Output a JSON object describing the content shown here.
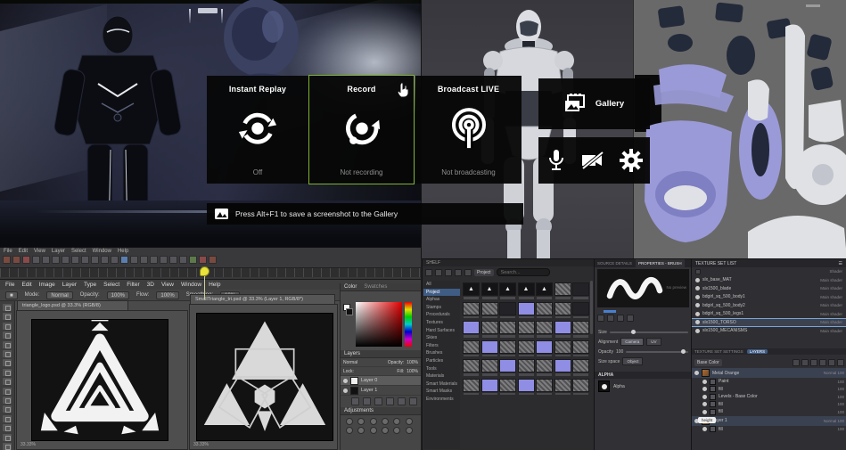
{
  "overlay": {
    "tiles": [
      {
        "title": "Instant Replay",
        "status": "Off"
      },
      {
        "title": "Record",
        "status": "Not recording"
      },
      {
        "title": "Broadcast LIVE",
        "status": "Not broadcasting"
      }
    ],
    "gallery_label": "Gallery",
    "notification": "Press Alt+F1 to save a screenshot to the Gallery",
    "accent_green": "#7fb22e"
  },
  "upper_app": {
    "menus": [
      "File",
      "Edit",
      "View",
      "Layer",
      "Select",
      "Window",
      "Help"
    ]
  },
  "photoshop": {
    "menus": [
      "File",
      "Edit",
      "Image",
      "Layer",
      "Type",
      "Select",
      "Filter",
      "3D",
      "View",
      "Window",
      "Help"
    ],
    "options": {
      "mode_label": "Mode:",
      "mode": "Normal",
      "opacity_label": "Opacity:",
      "opacity": "100%",
      "flow_label": "Flow:",
      "flow": "100%",
      "smoothing_label": "Smoothing:",
      "smoothing": "10%"
    },
    "tools": [
      "move",
      "marquee",
      "lasso",
      "wand",
      "crop",
      "eyedropper",
      "heal",
      "brush",
      "stamp",
      "eraser",
      "gradient",
      "pen",
      "type",
      "shape",
      "hand",
      "zoom"
    ],
    "doc1": {
      "tab": "triangle_logo.psd @ 33.3% (RGB/8)",
      "zoom": "33.33%"
    },
    "doc2": {
      "tab": "SmallTriangle_tri.psd @ 33.3% (Layer 1, RGB/8*)",
      "zoom": "33.33%"
    },
    "color_panel": {
      "tab_color": "Color",
      "tab_swatches": "Swatches"
    },
    "layers_panel": {
      "title": "Layers",
      "blend": "Normal",
      "opacity_label": "Opacity:",
      "opacity": "100%",
      "lock_label": "Lock:",
      "fill_label": "Fill:",
      "fill": "100%",
      "layers": [
        {
          "name": "Layer 0"
        },
        {
          "name": "Layer 1"
        }
      ]
    },
    "adjustments_title": "Adjustments"
  },
  "shelf": {
    "title": "SHELF",
    "filter_chip": "Project",
    "search_placeholder": "Search...",
    "categories": [
      "All",
      "Project",
      "Alphas",
      "Stamps",
      "Procedurals",
      "Textures",
      "Hard Surfaces",
      "Skies",
      "Filters",
      "Brushes",
      "Particles",
      "Tools",
      "Materials",
      "Smart Materials",
      "Smart Masks",
      "Environments"
    ],
    "selected_category": "Project",
    "grid": [
      "aaaaand",
      "nndpnnd",
      "pnnnnpn",
      "npnnpnn",
      "nnpnnpn",
      "npnpnnn"
    ],
    "triangle_glyph": "▲"
  },
  "properties": {
    "tabs": [
      "SOURCE DETAILS",
      "PROPERTIES - BRUSH"
    ],
    "active_tab": "PROPERTIES - BRUSH",
    "no_preview": "No preview",
    "size_label": "Size",
    "alignment_label": "Alignment",
    "alignment_options": [
      "Camera",
      "UV"
    ],
    "alignment_selected": "Camera",
    "opacity_label": "Opacity",
    "opacity_value": "100",
    "size_space_label": "Size space",
    "size_space_value": "Object",
    "alpha_section": "ALPHA",
    "alpha_name": "Alpha"
  },
  "texture_sets": {
    "title": "TEXTURE SET LIST",
    "shader_header": "Shader",
    "shader": "Main shader",
    "items": [
      "slx_base_MAT",
      "slx1500_blade",
      "bdgirl_sq_500_body1",
      "bdgirl_sq_500_body2",
      "bdgirl_sq_500_legs1",
      "slx1500_TORSO",
      "slx1500_MECANISMS"
    ],
    "selected": "slx1500_TORSO"
  },
  "layers_sp": {
    "tabs": [
      "TEXTURE SET SETTINGS",
      "LAYERS"
    ],
    "active_tab": "LAYERS",
    "channel": "Base Color",
    "groups": [
      {
        "name": "Metal Orange",
        "blend": "Normal",
        "pct": "100",
        "children": [
          {
            "name": "Paint",
            "pct": "100"
          },
          {
            "name": "fill",
            "pct": "100"
          },
          {
            "name": "Levels - Base Color",
            "pct": "100"
          },
          {
            "name": "fill",
            "pct": "100"
          },
          {
            "name": "fill",
            "pct": "100"
          }
        ]
      },
      {
        "name": "Layer 1",
        "blend": "Normal",
        "pct": "100",
        "children": [
          {
            "name": "fill",
            "pct": "100"
          }
        ]
      }
    ],
    "height_chip": "height"
  }
}
